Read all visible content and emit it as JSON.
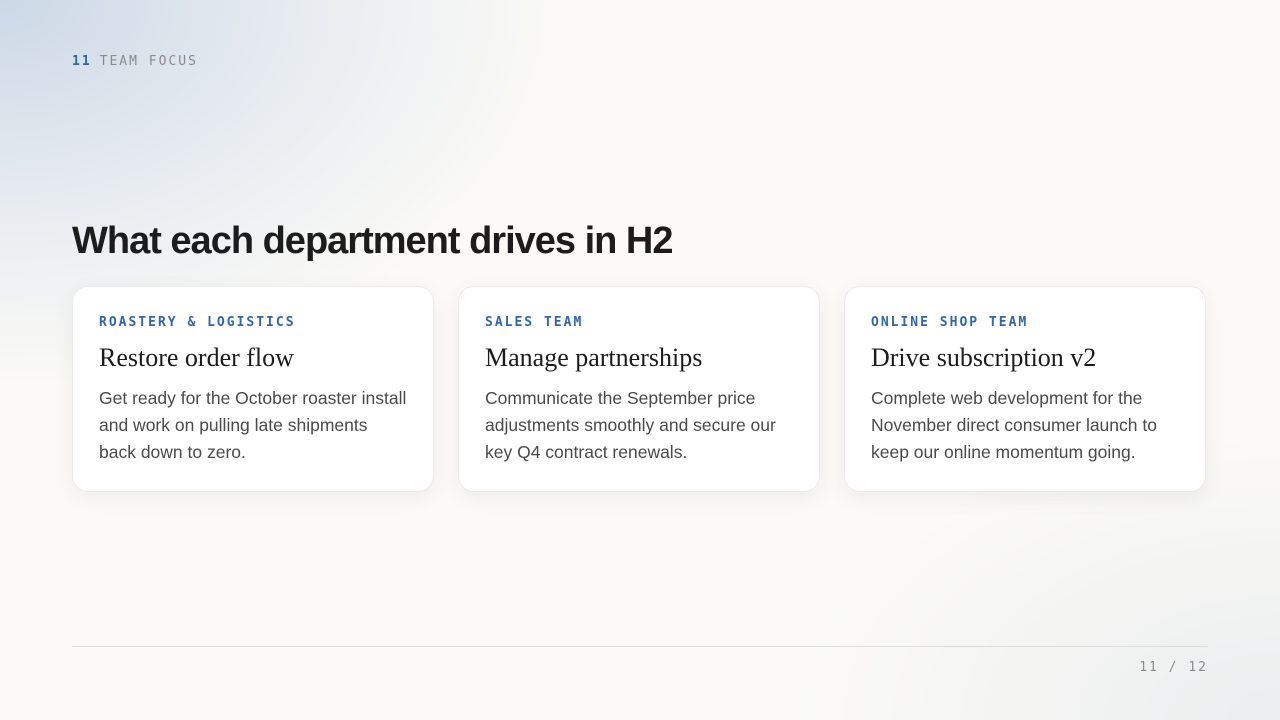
{
  "section": {
    "number": "11",
    "label": "TEAM FOCUS"
  },
  "title": "What each department drives in H2",
  "cards": [
    {
      "tag": "ROASTERY & LOGISTICS",
      "title": "Restore order flow",
      "body": "Get ready for the October roaster install and work on pulling late shipments back down to zero."
    },
    {
      "tag": "SALES TEAM",
      "title": "Manage partnerships",
      "body": "Communicate the September price adjustments smoothly and secure our key Q4 contract renewals."
    },
    {
      "tag": "ONLINE SHOP TEAM",
      "title": "Drive subscription v2",
      "body": "Complete web development for the November direct consumer launch to keep our online momentum going."
    }
  ],
  "pager": "11 / 12",
  "colors": {
    "accent": "#2f66ad",
    "text": "#1c1c1c",
    "muted": "#8a8a8a"
  }
}
